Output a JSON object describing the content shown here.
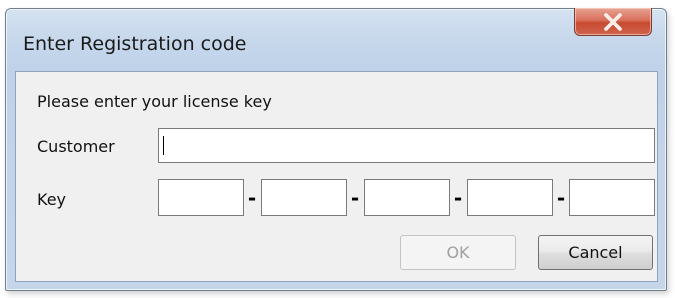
{
  "window": {
    "title": "Enter Registration code",
    "close_icon": "close-icon"
  },
  "form": {
    "prompt": "Please enter your license key",
    "customer_label": "Customer",
    "customer_value": "",
    "key_label": "Key",
    "key_segments": [
      "",
      "",
      "",
      "",
      ""
    ],
    "separator": "-"
  },
  "buttons": {
    "ok_label": "OK",
    "ok_enabled": false,
    "cancel_label": "Cancel"
  }
}
